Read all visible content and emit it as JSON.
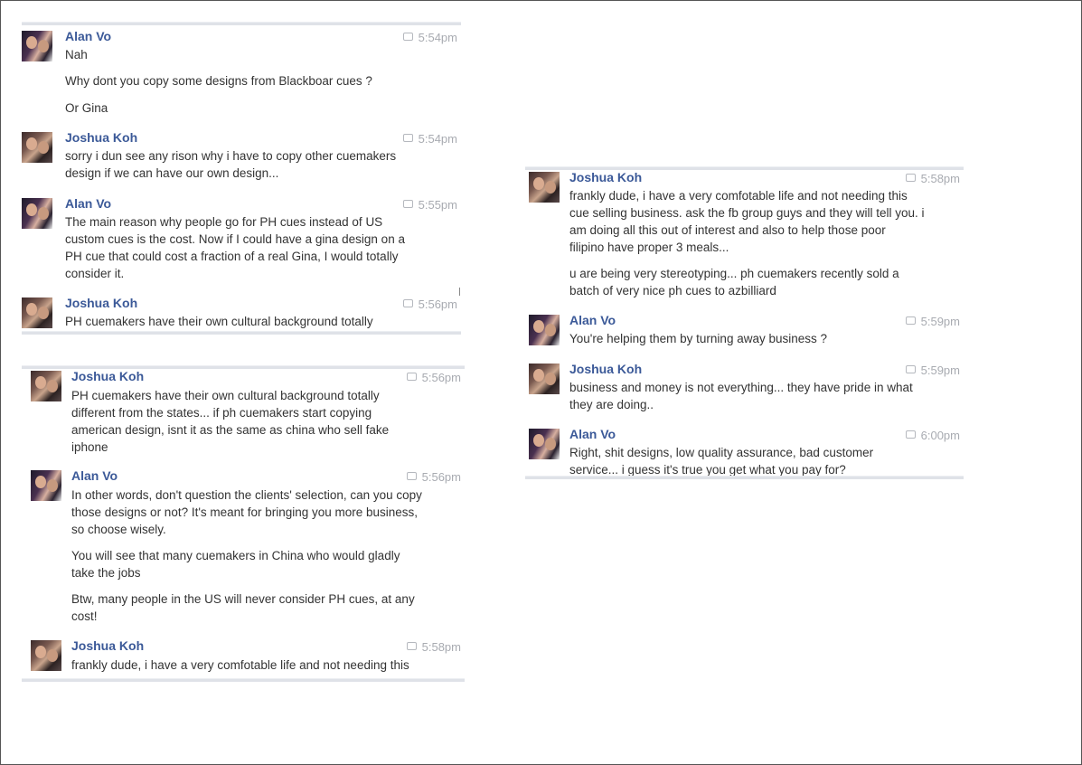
{
  "panels": [
    {
      "messages": [
        {
          "author": "Alan Vo",
          "time": "5:54pm",
          "lines": [
            "Nah",
            "Why dont you copy some designs from Blackboar cues ?",
            "Or Gina"
          ]
        },
        {
          "author": "Joshua Koh",
          "time": "5:54pm",
          "lines": [
            "sorry i dun see any rison why i have to copy other cuemakers",
            "design if we can have our own design..."
          ]
        },
        {
          "author": "Alan Vo",
          "time": "5:55pm",
          "lines": [
            "The main reason why people go for PH cues instead of US",
            "custom cues is the cost. Now if I could have a gina design on a",
            "PH cue that could cost a fraction of a real Gina, I would totally",
            "consider it."
          ]
        },
        {
          "author": "Joshua Koh",
          "time": "5:56pm",
          "lines": [
            "PH cuemakers have their own cultural background totally"
          ]
        }
      ]
    },
    {
      "messages": [
        {
          "author": "Joshua Koh",
          "time": "5:56pm",
          "lines": [
            "PH cuemakers have their own cultural background totally",
            "different from the states... if ph cuemakers start copying",
            "american design, isnt it as the same as china who sell fake",
            "iphone"
          ]
        },
        {
          "author": "Alan Vo",
          "time": "5:56pm",
          "lines": [
            "In other words, don't question the clients' selection, can you copy",
            "those designs or not? It's meant for bringing you more business,",
            "so choose wisely.",
            "You will see that many cuemakers in China who would gladly",
            "take the jobs",
            "Btw, many people in the US will never consider PH cues, at any",
            "cost!"
          ]
        },
        {
          "author": "Joshua Koh",
          "time": "5:58pm",
          "lines": [
            "frankly dude, i have a very comfotable life and not needing this"
          ]
        }
      ]
    },
    {
      "messages": [
        {
          "author": "Joshua Koh",
          "time": "5:58pm",
          "lines": [
            "frankly dude, i have a very comfotable life and not needing this",
            "cue selling business. ask the fb group guys and they will tell you. i",
            "am doing all this out of interest and also to help those poor",
            "filipino have proper 3 meals...",
            "u are being very stereotyping... ph cuemakers recently sold a",
            "batch of very nice ph cues to azbilliard"
          ]
        },
        {
          "author": "Alan Vo",
          "time": "5:59pm",
          "lines": [
            "You're helping them by turning away business ?"
          ]
        },
        {
          "author": "Joshua Koh",
          "time": "5:59pm",
          "lines": [
            "business and money is not everything... they have pride in what",
            "they are doing.."
          ]
        },
        {
          "author": "Alan Vo",
          "time": "6:00pm",
          "lines": [
            "Right, shit designs, low quality assurance, bad customer",
            "service... i guess it's true you get what you pay for?"
          ]
        }
      ]
    }
  ]
}
